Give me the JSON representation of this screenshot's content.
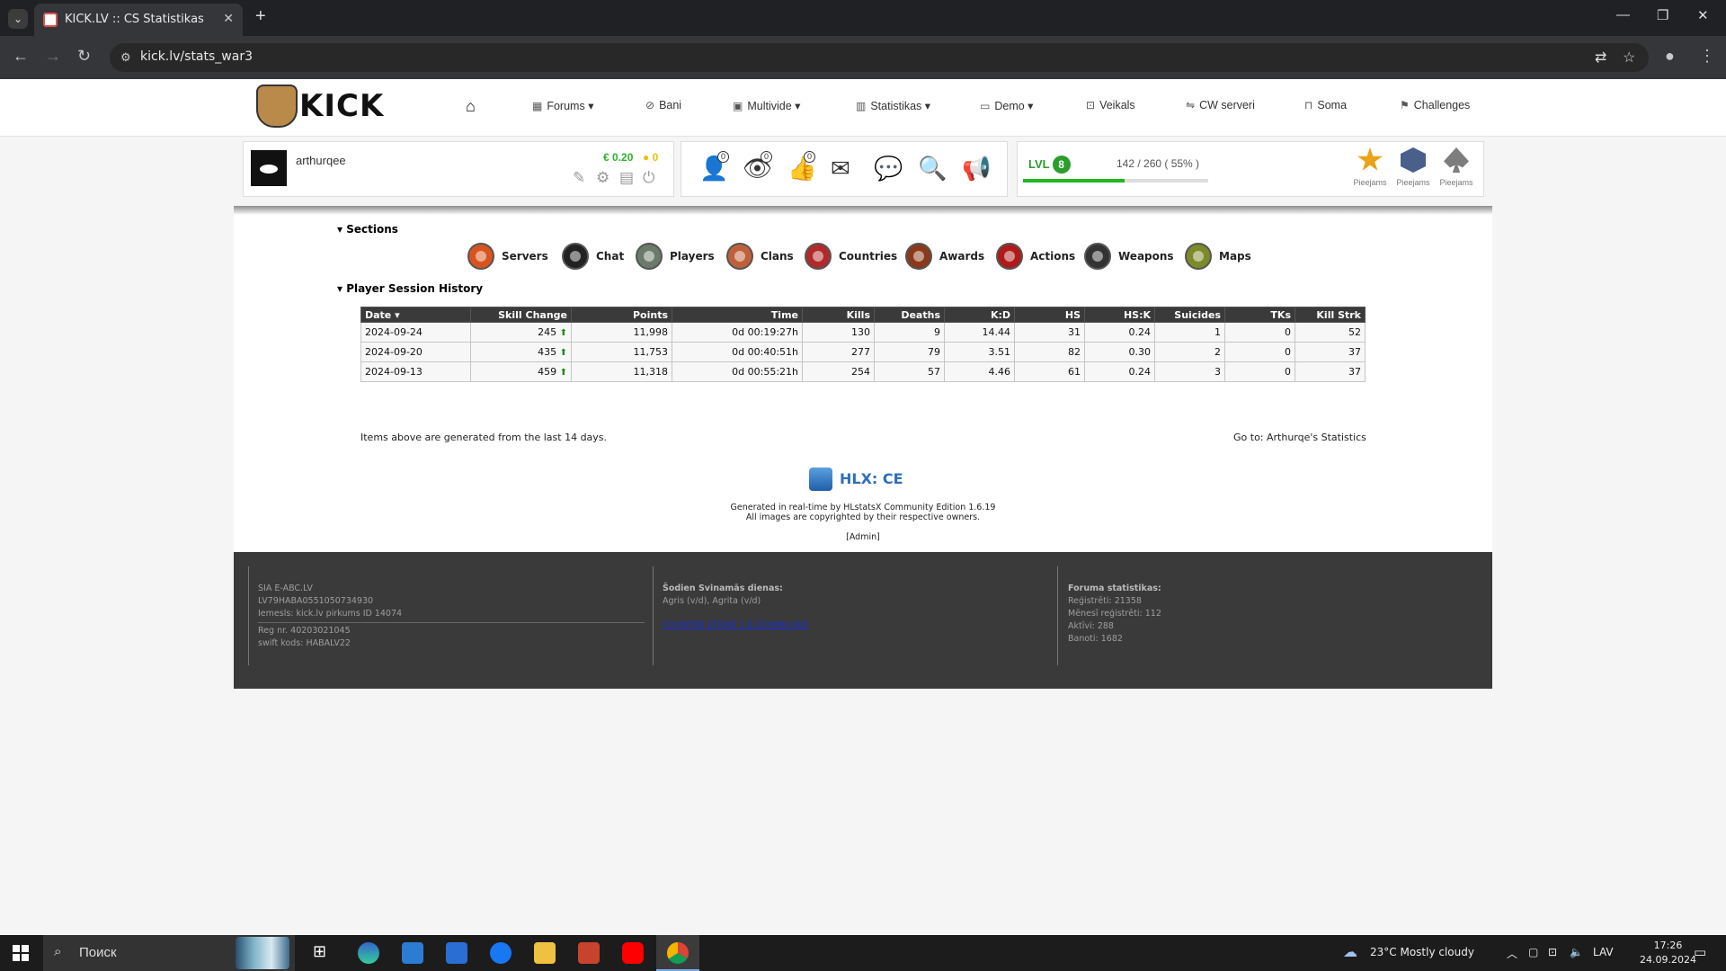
{
  "browser": {
    "tab_title": "KICK.LV :: CS Statistikas",
    "url": "kick.lv/stats_war3"
  },
  "nav": {
    "items": [
      {
        "label": "Forums",
        "icon": "grid-icon",
        "dropdown": true
      },
      {
        "label": "Bani",
        "icon": "ban-icon",
        "dropdown": false
      },
      {
        "label": "Multivide",
        "icon": "film-icon",
        "dropdown": true
      },
      {
        "label": "Statistikas",
        "icon": "bar-chart-icon",
        "dropdown": true
      },
      {
        "label": "Demo",
        "icon": "tv-icon",
        "dropdown": true
      },
      {
        "label": "Veikals",
        "icon": "cart-icon",
        "dropdown": false
      },
      {
        "label": "CW serveri",
        "icon": "handshake-icon",
        "dropdown": false
      },
      {
        "label": "Soma",
        "icon": "bag-icon",
        "dropdown": false
      },
      {
        "label": "Challenges",
        "icon": "flag-icon",
        "dropdown": false
      }
    ]
  },
  "user": {
    "name": "arthurqee",
    "money": "€ 0.20",
    "coins": "0",
    "badges": {
      "friends": "0",
      "views": "0",
      "likes": "0"
    }
  },
  "level": {
    "label": "LVL",
    "value": "8",
    "xp_text": "142 / 260 ( 55% )",
    "progress": 0.55,
    "achievements": [
      {
        "label": "Pieejams",
        "color": "#e8a319"
      },
      {
        "label": "Pieejams",
        "color": "#4a5f8a"
      },
      {
        "label": "Pieejams",
        "color": "#7d7d7d"
      }
    ]
  },
  "sections": {
    "title": "Sections",
    "items": [
      {
        "label": "Servers",
        "color": "#d9531e"
      },
      {
        "label": "Chat",
        "color": "#222222"
      },
      {
        "label": "Players",
        "color": "#6b7a6b"
      },
      {
        "label": "Clans",
        "color": "#c0603a"
      },
      {
        "label": "Countries",
        "color": "#b02a2a"
      },
      {
        "label": "Awards",
        "color": "#8a3a1a"
      },
      {
        "label": "Actions",
        "color": "#b01a1a"
      },
      {
        "label": "Weapons",
        "color": "#333333"
      },
      {
        "label": "Maps",
        "color": "#7c8a2a"
      }
    ]
  },
  "history": {
    "title": "Player Session History",
    "columns": [
      "Date",
      "Skill Change",
      "Points",
      "Time",
      "Kills",
      "Deaths",
      "K:D",
      "HS",
      "HS:K",
      "Suicides",
      "TKs",
      "Kill Strk"
    ],
    "rows": [
      [
        "2024-09-24",
        "245",
        "11,998",
        "0d 00:19:27h",
        "130",
        "9",
        "14.44",
        "31",
        "0.24",
        "1",
        "0",
        "52"
      ],
      [
        "2024-09-20",
        "435",
        "11,753",
        "0d 00:40:51h",
        "277",
        "79",
        "3.51",
        "82",
        "0.30",
        "2",
        "0",
        "37"
      ],
      [
        "2024-09-13",
        "459",
        "11,318",
        "0d 00:55:21h",
        "254",
        "57",
        "4.46",
        "61",
        "0.24",
        "3",
        "0",
        "37"
      ]
    ],
    "note": "Items above are generated from the last 14 days.",
    "goto": "Go to: Arthurqe's Statistics"
  },
  "hlx": {
    "logo": "HLX: CE",
    "generated": "Generated in real-time by HLstatsX Community Edition 1.6.19",
    "copyright": "All images are copyrighted by their respective owners.",
    "admin": "[Admin]"
  },
  "footer": {
    "col1": [
      "SIA E-ABC.LV",
      "LV79HABA0551050734930",
      "Iemesls: kick.lv pirkums ID 14074",
      "Reg nr. 40203021045",
      "swift kods: HABALV22"
    ],
    "col2_title": "Šodien Svinamās dienas:",
    "col2_names": "Agris (v/d), Agrita (v/d)",
    "col2_link": "COUNTER STRIKE 1.6 DOWNLOAD",
    "col3_title": "Foruma statistikas:",
    "col3": [
      "Reģistrēti: 21358",
      "Mēnesī reģistrēti: 112",
      "Aktīvi: 288",
      "Banoti: 1682"
    ]
  },
  "taskbar": {
    "search": "Поиск",
    "weather": "23°C  Mostly cloudy",
    "lang": "LAV",
    "time": "17:26",
    "date": "24.09.2024"
  }
}
